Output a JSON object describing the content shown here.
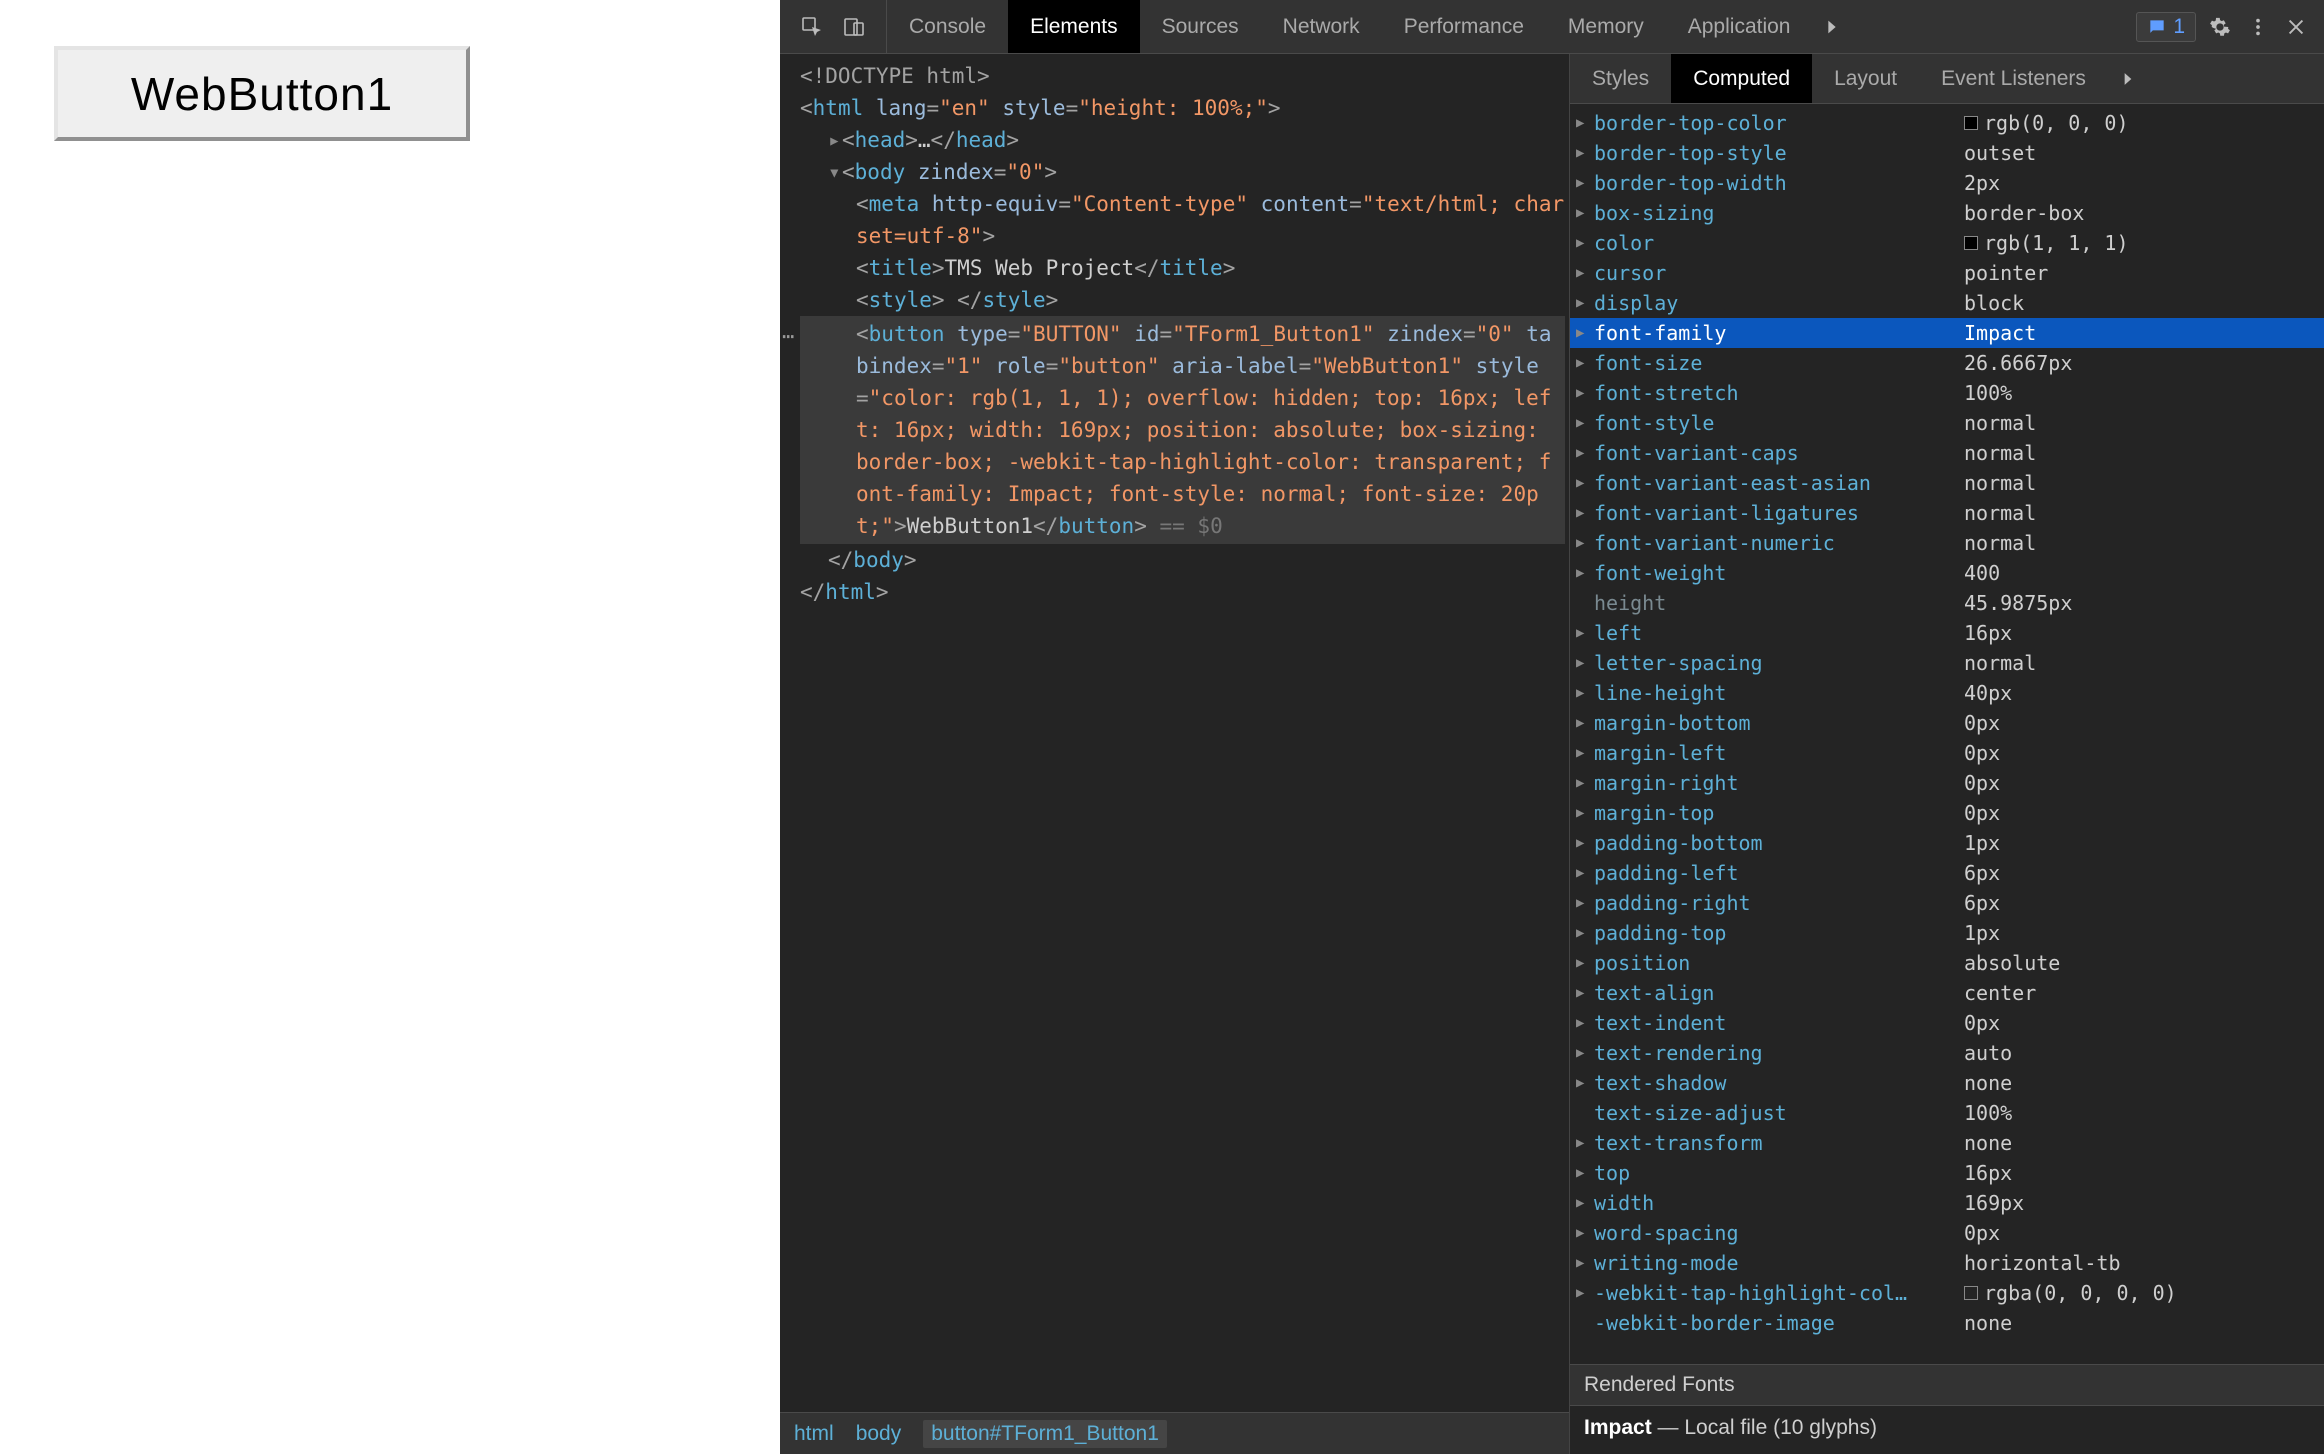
{
  "preview": {
    "button_label": "WebButton1"
  },
  "devtools": {
    "tabs": [
      "Console",
      "Elements",
      "Sources",
      "Network",
      "Performance",
      "Memory",
      "Application"
    ],
    "active_tab": "Elements",
    "review_count": "1",
    "breadcrumb": [
      "html",
      "body",
      "button#TForm1_Button1"
    ],
    "dom": {
      "doctype": "<!DOCTYPE html>",
      "html_open": {
        "tag": "html",
        "attrs": [
          [
            "lang",
            "en"
          ],
          [
            "style",
            "height: 100%;"
          ]
        ]
      },
      "head": "<head>…</head>",
      "body_open": {
        "tag": "body",
        "attrs": [
          [
            "zindex",
            "0"
          ]
        ]
      },
      "meta": {
        "tag": "meta",
        "attrs": [
          [
            "http-equiv",
            "Content-type"
          ],
          [
            "content",
            "text/html; charset=utf-8"
          ]
        ]
      },
      "title_text": "TMS Web Project",
      "style_empty": "<style> </style>",
      "button_attrs_text": "type=\"BUTTON\" id=\"TForm1_Button1\" zindex=\"0\" tabindex=\"1\" role=\"button\" aria-label=\"WebButton1\" style=\"color: rgb(1, 1, 1); overflow: hidden; top: 16px; left: 16px; width: 169px; position: absolute; box-sizing: border-box; -webkit-tap-highlight-color: transparent; font-family: Impact; font-style: normal; font-size: 20pt;\"",
      "button_text": "WebButton1",
      "eq0": "== $0"
    },
    "side_tabs": [
      "Styles",
      "Computed",
      "Layout",
      "Event Listeners"
    ],
    "side_active": "Computed",
    "computed": [
      {
        "n": "border-top-color",
        "v": "rgb(0, 0, 0)",
        "sw": "#000000"
      },
      {
        "n": "border-top-style",
        "v": "outset"
      },
      {
        "n": "border-top-width",
        "v": "2px"
      },
      {
        "n": "box-sizing",
        "v": "border-box"
      },
      {
        "n": "color",
        "v": "rgb(1, 1, 1)",
        "sw": "#010101"
      },
      {
        "n": "cursor",
        "v": "pointer"
      },
      {
        "n": "display",
        "v": "block"
      },
      {
        "n": "font-family",
        "v": "Impact",
        "hl": true
      },
      {
        "n": "font-size",
        "v": "26.6667px"
      },
      {
        "n": "font-stretch",
        "v": "100%"
      },
      {
        "n": "font-style",
        "v": "normal"
      },
      {
        "n": "font-variant-caps",
        "v": "normal"
      },
      {
        "n": "font-variant-east-asian",
        "v": "normal"
      },
      {
        "n": "font-variant-ligatures",
        "v": "normal"
      },
      {
        "n": "font-variant-numeric",
        "v": "normal"
      },
      {
        "n": "font-weight",
        "v": "400"
      },
      {
        "n": "height",
        "v": "45.9875px",
        "dim": true
      },
      {
        "n": "left",
        "v": "16px"
      },
      {
        "n": "letter-spacing",
        "v": "normal"
      },
      {
        "n": "line-height",
        "v": "40px"
      },
      {
        "n": "margin-bottom",
        "v": "0px"
      },
      {
        "n": "margin-left",
        "v": "0px"
      },
      {
        "n": "margin-right",
        "v": "0px"
      },
      {
        "n": "margin-top",
        "v": "0px"
      },
      {
        "n": "padding-bottom",
        "v": "1px"
      },
      {
        "n": "padding-left",
        "v": "6px"
      },
      {
        "n": "padding-right",
        "v": "6px"
      },
      {
        "n": "padding-top",
        "v": "1px"
      },
      {
        "n": "position",
        "v": "absolute"
      },
      {
        "n": "text-align",
        "v": "center"
      },
      {
        "n": "text-indent",
        "v": "0px"
      },
      {
        "n": "text-rendering",
        "v": "auto"
      },
      {
        "n": "text-shadow",
        "v": "none"
      },
      {
        "n": "text-size-adjust",
        "v": "100%",
        "noarrow": true
      },
      {
        "n": "text-transform",
        "v": "none"
      },
      {
        "n": "top",
        "v": "16px"
      },
      {
        "n": "width",
        "v": "169px"
      },
      {
        "n": "word-spacing",
        "v": "0px"
      },
      {
        "n": "writing-mode",
        "v": "horizontal-tb"
      },
      {
        "n": "-webkit-tap-highlight-col…",
        "v": "rgba(0, 0, 0, 0)",
        "sw": "rgba(0,0,0,0)"
      },
      {
        "n": "-webkit-border-image",
        "v": "none",
        "noarrow": true
      }
    ],
    "rendered_fonts_header": "Rendered Fonts",
    "rendered_font_name": "Impact",
    "rendered_font_detail": "— Local file (10 glyphs)"
  }
}
